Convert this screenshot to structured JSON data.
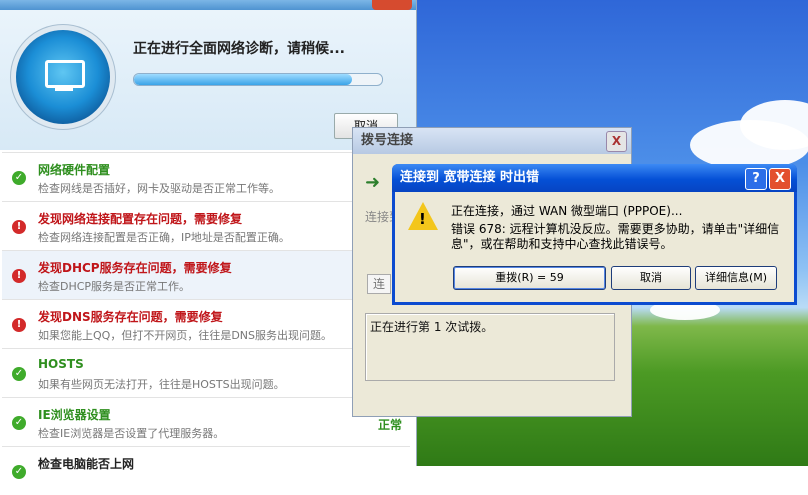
{
  "tool": {
    "status_text": "正在进行全面网络诊断，请稍候...",
    "progress_fraction": 0.88,
    "cancel_label": "取消",
    "items": [
      {
        "title": "网络硬件配置",
        "desc": "检查网线是否插好，网卡及驱动是否正常工作等。",
        "state": "ok"
      },
      {
        "title": "发现网络连接配置存在问题，需要修复",
        "desc": "检查网络连接配置是否正确，IP地址是否配置正确。",
        "state": "error"
      },
      {
        "title": "发现DHCP服务存在问题，需要修复",
        "desc": "检查DHCP服务是否正常工作。",
        "state": "error"
      },
      {
        "title": "发现DNS服务存在问题，需要修复",
        "desc": "如果您能上QQ，但打不开网页，往往是DNS服务出现问题。",
        "state": "error"
      },
      {
        "title": "HOSTS",
        "desc": "如果有些网页无法打开，往往是HOSTS出现问题。",
        "state": "ok"
      },
      {
        "title": "IE浏览器设置",
        "desc": "检查IE浏览器是否设置了代理服务器。",
        "state": "ok",
        "result": "正常"
      },
      {
        "title": "检查电脑能否上网",
        "desc": "",
        "state": "ok"
      }
    ]
  },
  "dial": {
    "title": "拨号连接",
    "close": "X",
    "label": "连接到",
    "status": "正在进行第 1 次试拨。"
  },
  "error_dialog": {
    "title": "连接到 宽带连接 时出错",
    "help": "?",
    "close": "X",
    "message1": "正在连接，通过 WAN 微型端口 (PPPOE)...",
    "message2": "错误 678: 远程计算机没反应。需要更多协助，请单击\"详细信息\"，或在帮助和支持中心查找此错误号。",
    "redial_button": "重拨(R) = 59",
    "cancel_button": "取消",
    "details_button": "详细信息(M)"
  }
}
